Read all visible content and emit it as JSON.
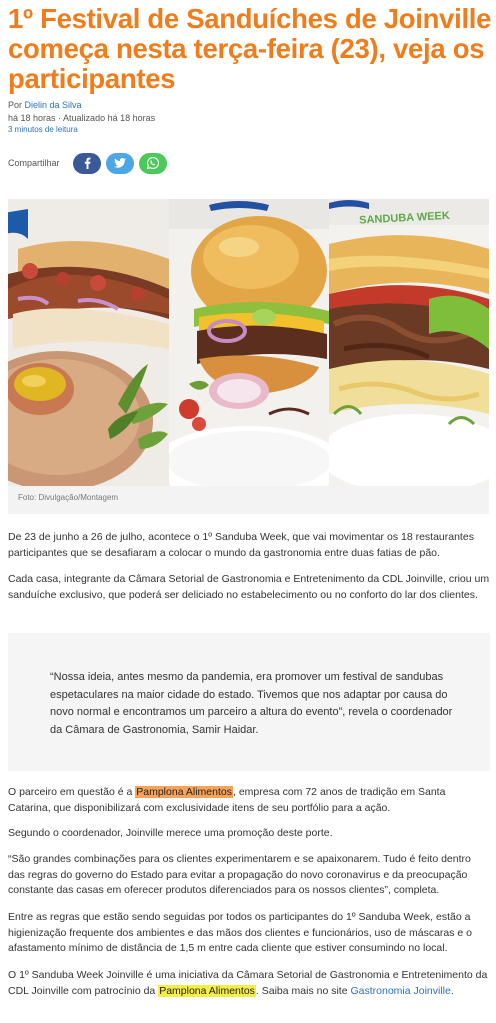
{
  "article": {
    "title": "1º Festival de Sanduíches de Joinville começa nesta terça-feira (23), veja os participantes",
    "by_prefix": "Por ",
    "author": "Dielin da Silva",
    "published": "há 18 horas",
    "updated": " · Atualizado há 18 horas",
    "read_time": "3 minutos de leitura"
  },
  "share": {
    "label": "Compartilhar",
    "buttons": [
      {
        "name": "facebook",
        "color": "#3b5998",
        "icon": "facebook-icon"
      },
      {
        "name": "twitter",
        "color": "#4fa6e6",
        "icon": "twitter-icon"
      },
      {
        "name": "whatsapp",
        "color": "#4cc95b",
        "icon": "whatsapp-icon"
      }
    ]
  },
  "figure": {
    "caption": "Foto: Divulgação/Montagem",
    "watermark_brand": "SANDUBA WEEK"
  },
  "body": {
    "p1": "De 23 de junho a 26 de julho, acontece o 1º Sanduba Week, que vai movimentar os 18 restaurantes participantes que se desafiaram a colocar o mundo da gastronomia entre duas fatias de pão.",
    "p2": "Cada casa, integrante da Câmara Setorial de Gastronomia e Entretenimento da CDL Joinville, criou um sanduíche exclusivo, que poderá ser deliciado no estabelecimento ou no conforto do lar dos clientes.",
    "quote": "“Nossa ideia, antes mesmo da pandemia, era promover um festival de sandubas espetaculares na maior cidade do estado. Tivemos que nos adaptar por causa do novo normal e encontramos um parceiro a altura do evento”, revela o coordenador da Câmara de Gastronomia, Samir Haidar.",
    "p3_a": "O parceiro em questão é a ",
    "p3_hl": "Pamplona Alimentos",
    "p3_b": ", empresa com 72 anos de tradição em Santa Catarina, que disponibilizará com exclusividade itens de seu portfólio para a ação.",
    "p4": "Segundo o coordenador, Joinville merece uma promoção deste porte.",
    "p5": "“São grandes combinações para os clientes experimentarem e se apaixonarem. Tudo é feito dentro das regras do governo do Estado para evitar a propagação do novo coronavirus e da preocupação constante das casas em oferecer produtos diferenciados para os nossos clientes”, completa.",
    "p6": "Entre as regras que estão sendo seguidas por todos os participantes do 1º Sanduba Week, estão a higienização frequente dos ambientes e das mãos dos clientes e funcionários, uso de máscaras e o afastamento mínimo de distância de 1,5 m entre cada cliente que estiver consumindo no local.",
    "p7_a": "O 1º Sanduba Week Joinville é uma iniciativa da Câmara Setorial de Gastronomia e Entretenimento da CDL Joinville com patrocínio da ",
    "p7_hl": "Pamplona Alimentos",
    "p7_b": ". Saiba mais no site ",
    "p7_link": "Gastronomia Joinville",
    "p7_end": "."
  }
}
